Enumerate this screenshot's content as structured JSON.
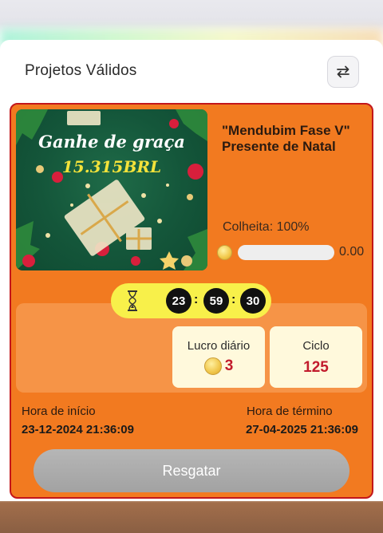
{
  "header": {
    "title": "Projetos Válidos",
    "switch_icon": "switch-arrows-icon"
  },
  "project": {
    "banner_line1": "Ganhe de graça",
    "banner_line2": "15.315BRL",
    "name": "\"Mendubim Fase V\" Presente de Natal",
    "harvest_label": "Colheita: 100%",
    "progress_value": "0.00",
    "progress_fraction": 0.0
  },
  "timer": {
    "hours": "23",
    "minutes": "59",
    "seconds": "30",
    "sep": ":"
  },
  "stats": {
    "daily_profit_label": "Lucro diário",
    "daily_profit_value": "3",
    "cycle_label": "Ciclo",
    "cycle_value": "125"
  },
  "dates": {
    "start_label": "Hora de início",
    "start_value": "23-12-2024 21:36:09",
    "end_label": "Hora de término",
    "end_value": "27-04-2025 21:36:09"
  },
  "actions": {
    "redeem_label": "Resgatar"
  },
  "colors": {
    "card": "#f27a20",
    "card_border": "#c3161b",
    "timer_bg": "#f8f04a",
    "value_red": "#c21b2c",
    "button_disabled": "#a8a8a8"
  }
}
